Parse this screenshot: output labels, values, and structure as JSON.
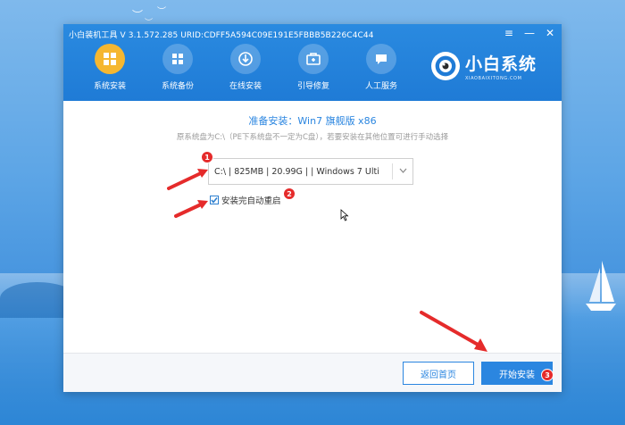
{
  "window": {
    "title": "小白装机工具 V 3.1.572.285 URID:CDFF5A594C09E191E5FBBB5B226C4C44",
    "controls": {
      "menu": "≡",
      "minimize": "—",
      "close": "✕"
    }
  },
  "nav": {
    "items": [
      {
        "label": "系统安装",
        "icon": "system-install-icon",
        "active": true
      },
      {
        "label": "系统备份",
        "icon": "system-backup-icon",
        "active": false
      },
      {
        "label": "在线安装",
        "icon": "online-install-icon",
        "active": false
      },
      {
        "label": "引导修复",
        "icon": "boot-repair-icon",
        "active": false
      },
      {
        "label": "人工服务",
        "icon": "human-service-icon",
        "active": false
      }
    ]
  },
  "brand": {
    "name": "小白系统",
    "subtitle": "XIAOBAIXITONG.COM"
  },
  "content": {
    "title": "准备安装：Win7 旗舰版 x86",
    "hint": "原系统盘为C:\\（PE下系统盘不一定为C盘），若要安装在其他位置可进行手动选择",
    "partition_select": {
      "value": "C:\\ | 825MB | 20.99G | | Windows 7 Ulti"
    },
    "auto_restart": {
      "label": "安装完自动重启",
      "checked": true
    }
  },
  "annotations": {
    "badge1": "1",
    "badge2": "2",
    "badge3": "3"
  },
  "footer": {
    "back_label": "返回首页",
    "start_label": "开始安装"
  },
  "colors": {
    "accent": "#2b86e0",
    "header": "#1f7bd6",
    "active_icon": "#f5b731",
    "badge": "#e52b2b"
  }
}
